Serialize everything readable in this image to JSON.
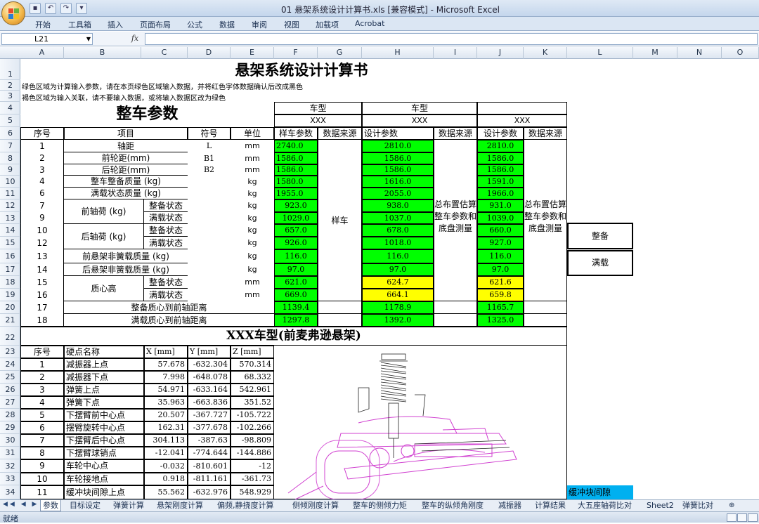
{
  "window": {
    "title": "01 悬架系统设计计算书.xls  [兼容模式] - Microsoft Excel"
  },
  "ribbon": {
    "tabs": [
      "开始",
      "工具箱",
      "插入",
      "页面布局",
      "公式",
      "数据",
      "审阅",
      "视图",
      "加载项",
      "Acrobat"
    ]
  },
  "formula_bar": {
    "cell_ref": "L21",
    "fx": "fx",
    "value": ""
  },
  "columns": [
    "A",
    "B",
    "C",
    "D",
    "E",
    "F",
    "G",
    "H",
    "I",
    "J",
    "K",
    "L",
    "M",
    "N",
    "O"
  ],
  "rows": [
    "1",
    "2",
    "3",
    "4",
    "5",
    "6",
    "7",
    "8",
    "9",
    "10",
    "11",
    "12",
    "13",
    "14",
    "15",
    "16",
    "17",
    "18",
    "19",
    "20",
    "21",
    "22",
    "23",
    "24",
    "25",
    "26",
    "27",
    "28",
    "29",
    "30",
    "31",
    "32",
    "33",
    "34"
  ],
  "sheet": {
    "title": "悬架系统设计计算书",
    "note1": "绿色区域为计算输入参数，请在本页绿色区域输入数据，并将红色字体数据确认后改成黑色",
    "note2": "褐色区域为输入关联，请不要输入数据，或将输入数据区改为绿色",
    "section1": "整车参数",
    "model_label": "车型",
    "model_f": "XXX",
    "model_h": "XXX",
    "model_j": "XXX",
    "hdr": {
      "seq": "序号",
      "item": "项目",
      "sym": "符号",
      "unit": "单位",
      "f": "样车参数",
      "g": "数据来源",
      "h": "设计参数",
      "i": "数据来源",
      "j": "设计参数",
      "k": "数据来源"
    },
    "source_g": "样车",
    "source_i": "总布置估算整车参数和底盘测量",
    "source_k": "总布置估算整车参数和底盘测量",
    "params": [
      {
        "seq": "1",
        "item": "轴距",
        "sub": "",
        "sym": "L",
        "unit": "mm",
        "f": "2740.0",
        "h": "2810.0",
        "j": "2810.0"
      },
      {
        "seq": "2",
        "item": "前轮距(mm)",
        "sub": "",
        "sym": "B1",
        "unit": "mm",
        "f": "1586.0",
        "h": "1586.0",
        "j": "1586.0"
      },
      {
        "seq": "3",
        "item": "后轮距(mm)",
        "sub": "",
        "sym": "B2",
        "unit": "mm",
        "f": "1586.0",
        "h": "1586.0",
        "j": "1586.0"
      },
      {
        "seq": "4",
        "item": "整车整备质量 (kg)",
        "sub": "",
        "sym": "",
        "unit": "kg",
        "f": "1580.0",
        "h": "1616.0",
        "j": "1591.0"
      },
      {
        "seq": "6",
        "item": "满载状态质量 (kg)",
        "sub": "",
        "sym": "",
        "unit": "kg",
        "f": "1955.0",
        "h": "2055.0",
        "j": "1966.0"
      },
      {
        "seq": "7",
        "item": "前轴荷 (kg)",
        "sub": "整备状态",
        "sym": "",
        "unit": "kg",
        "f": "923.0",
        "h": "938.0",
        "j": "931.0"
      },
      {
        "seq": "9",
        "item": "",
        "sub": "满载状态",
        "sym": "",
        "unit": "kg",
        "f": "1029.0",
        "h": "1037.0",
        "j": "1039.0"
      },
      {
        "seq": "10",
        "item": "后轴荷 (kg)",
        "sub": "整备状态",
        "sym": "",
        "unit": "kg",
        "f": "657.0",
        "h": "678.0",
        "j": "660.0"
      },
      {
        "seq": "12",
        "item": "",
        "sub": "满载状态",
        "sym": "",
        "unit": "kg",
        "f": "926.0",
        "h": "1018.0",
        "j": "927.0"
      },
      {
        "seq": "13",
        "item": "前悬架非簧载质量 (kg)",
        "sub": "",
        "sym": "",
        "unit": "kg",
        "f": "116.0",
        "h": "116.0",
        "j": "116.0"
      },
      {
        "seq": "14",
        "item": "后悬架非簧载质量 (kg)",
        "sub": "",
        "sym": "",
        "unit": "kg",
        "f": "97.0",
        "h": "97.0",
        "j": "97.0"
      },
      {
        "seq": "15",
        "item": "质心高",
        "sub": "整备状态",
        "sym": "",
        "unit": "mm",
        "f": "621.0",
        "h": "624.7",
        "j": "621.6"
      },
      {
        "seq": "16",
        "item": "",
        "sub": "满载状态",
        "sym": "",
        "unit": "mm",
        "f": "669.0",
        "h": "664.1",
        "j": "659.8"
      },
      {
        "seq": "17",
        "item": "整备质心到前轴距离",
        "sub": "",
        "sym": "",
        "unit": "",
        "f": "1139.4",
        "h": "1178.9",
        "j": "1165.7"
      },
      {
        "seq": "18",
        "item": "满载质心到前轴距离",
        "sub": "",
        "sym": "",
        "unit": "",
        "f": "1297.8",
        "h": "1392.0",
        "j": "1325.0"
      }
    ],
    "side_buttons": {
      "l14": "整备",
      "l16": "满载"
    },
    "section2": "XXX车型(前麦弗逊悬架)",
    "hp_hdr": {
      "seq": "序号",
      "name": "硬点名称",
      "x": "X [mm]",
      "y": "Y [mm]",
      "z": "Z [mm]"
    },
    "hardpoints": [
      {
        "seq": "1",
        "name": "减振器上点",
        "x": "57.678",
        "y": "-632.304",
        "z": "570.314"
      },
      {
        "seq": "2",
        "name": "减振器下点",
        "x": "7.998",
        "y": "-648.078",
        "z": "68.332"
      },
      {
        "seq": "3",
        "name": "弹簧上点",
        "x": "54.971",
        "y": "-633.164",
        "z": "542.961"
      },
      {
        "seq": "4",
        "name": "弹簧下点",
        "x": "35.963",
        "y": "-663.836",
        "z": "351.52"
      },
      {
        "seq": "5",
        "name": "下摆臂前中心点",
        "x": "20.507",
        "y": "-367.727",
        "z": "-105.722"
      },
      {
        "seq": "6",
        "name": "摆臂旋转中心点",
        "x": "162.31",
        "y": "-377.678",
        "z": "-102.266"
      },
      {
        "seq": "7",
        "name": "下摆臂后中心点",
        "x": "304.113",
        "y": "-387.63",
        "z": "-98.809"
      },
      {
        "seq": "8",
        "name": "下摆臂球销点",
        "x": "-12.041",
        "y": "-774.644",
        "z": "-144.886"
      },
      {
        "seq": "9",
        "name": "车轮中心点",
        "x": "-0.032",
        "y": "-810.601",
        "z": "-12"
      },
      {
        "seq": "10",
        "name": "车轮接地点",
        "x": "0.918",
        "y": "-811.161",
        "z": "-361.73"
      },
      {
        "seq": "11",
        "name": "缓冲块间隙上点",
        "x": "55.562",
        "y": "-632.976",
        "z": "548.929"
      }
    ],
    "l34": "缓冲块间隙"
  },
  "sheet_tabs": [
    "参数",
    "目标设定",
    "弹簧计算",
    "悬架刚度计算",
    "偏频,静挠度计算",
    "侧倾刚度计算",
    "整车的侧倾力矩",
    "整车的纵倾角刚度",
    "减振器",
    "计算结果",
    "大五座轴荷比对",
    "Sheet2",
    "弹簧比对"
  ],
  "status": {
    "text": "就绪"
  },
  "colors": {
    "input_green": "#00ff00",
    "highlight_yellow": "#ffff00",
    "cyan": "#00b0f0",
    "figure_magenta": "#d040d0"
  }
}
